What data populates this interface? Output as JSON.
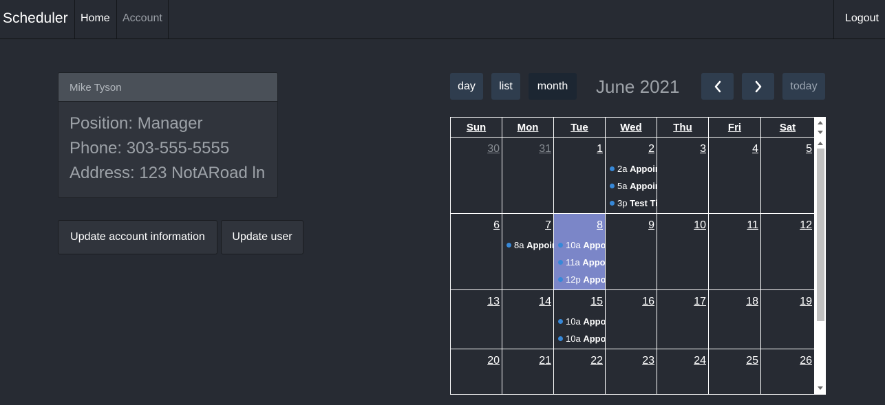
{
  "nav": {
    "brand": "Scheduler",
    "home": "Home",
    "account": "Account",
    "logout": "Logout"
  },
  "profile": {
    "name": "Mike Tyson",
    "position": "Position: Manager",
    "phone": "Phone: 303-555-5555",
    "address": "Address: 123 NotARoad ln"
  },
  "actions": {
    "update_account": "Update account information",
    "update_user": "Update user"
  },
  "calendar": {
    "title": "June 2021",
    "view_buttons": {
      "day": "day",
      "list": "list",
      "month": "month"
    },
    "today_button": "today",
    "active_view": "month",
    "days_of_week": [
      "Sun",
      "Mon",
      "Tue",
      "Wed",
      "Thu",
      "Fri",
      "Sat"
    ],
    "weeks": [
      [
        {
          "num": "30",
          "muted": true,
          "events": []
        },
        {
          "num": "31",
          "muted": true,
          "events": []
        },
        {
          "num": "1",
          "events": []
        },
        {
          "num": "2",
          "events": [
            {
              "time": "2a",
              "title": "Appointment"
            },
            {
              "time": "5a",
              "title": "Appointment"
            },
            {
              "time": "3p",
              "title": "Test Title"
            }
          ]
        },
        {
          "num": "3",
          "events": []
        },
        {
          "num": "4",
          "events": []
        },
        {
          "num": "5",
          "events": []
        }
      ],
      [
        {
          "num": "6",
          "events": []
        },
        {
          "num": "7",
          "events": [
            {
              "time": "8a",
              "title": "Appointment"
            }
          ]
        },
        {
          "num": "8",
          "today": true,
          "events": [
            {
              "time": "10a",
              "title": "Appointment"
            },
            {
              "time": "11a",
              "title": "Appointment"
            },
            {
              "time": "12p",
              "title": "Appointment"
            }
          ]
        },
        {
          "num": "9",
          "events": []
        },
        {
          "num": "10",
          "events": []
        },
        {
          "num": "11",
          "events": []
        },
        {
          "num": "12",
          "events": []
        }
      ],
      [
        {
          "num": "13",
          "events": []
        },
        {
          "num": "14",
          "events": []
        },
        {
          "num": "15",
          "events": [
            {
              "time": "10a",
              "title": "Appointment"
            },
            {
              "time": "10a",
              "title": "Appointment"
            }
          ]
        },
        {
          "num": "16",
          "events": []
        },
        {
          "num": "17",
          "events": []
        },
        {
          "num": "18",
          "events": []
        },
        {
          "num": "19",
          "events": []
        }
      ],
      [
        {
          "num": "20",
          "events": []
        },
        {
          "num": "21",
          "events": []
        },
        {
          "num": "22",
          "events": []
        },
        {
          "num": "23",
          "events": []
        },
        {
          "num": "24",
          "events": []
        },
        {
          "num": "25",
          "events": []
        },
        {
          "num": "26",
          "events": []
        }
      ]
    ],
    "colors": {
      "event_dot": "#3788d8",
      "today_highlight": "#7b86c8"
    }
  }
}
